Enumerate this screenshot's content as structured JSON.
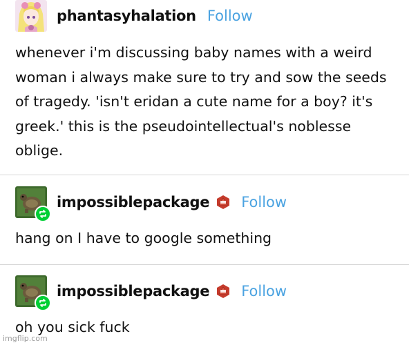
{
  "post1": {
    "username": "phantasyhalation",
    "follow_label": "Follow",
    "text": "whenever i'm discussing baby names with a weird woman i always make sure to try and sow the seeds of tragedy. 'isn't eridan a cute name for a boy? it's greek.' this is the pseudointellectual's noblesse oblige."
  },
  "reply1": {
    "username": "impossiblepackage",
    "follow_label": "Follow",
    "badge_icon": "d20-dice-icon",
    "text": "hang on I have to google something"
  },
  "reply2": {
    "username": "impossiblepackage",
    "follow_label": "Follow",
    "badge_icon": "d20-dice-icon",
    "text": "oh you sick fuck"
  },
  "watermark": "imgflip.com",
  "colors": {
    "follow": "#4ba3e1",
    "reblog_badge": "#00cf35",
    "divider": "#d6d6d6"
  }
}
